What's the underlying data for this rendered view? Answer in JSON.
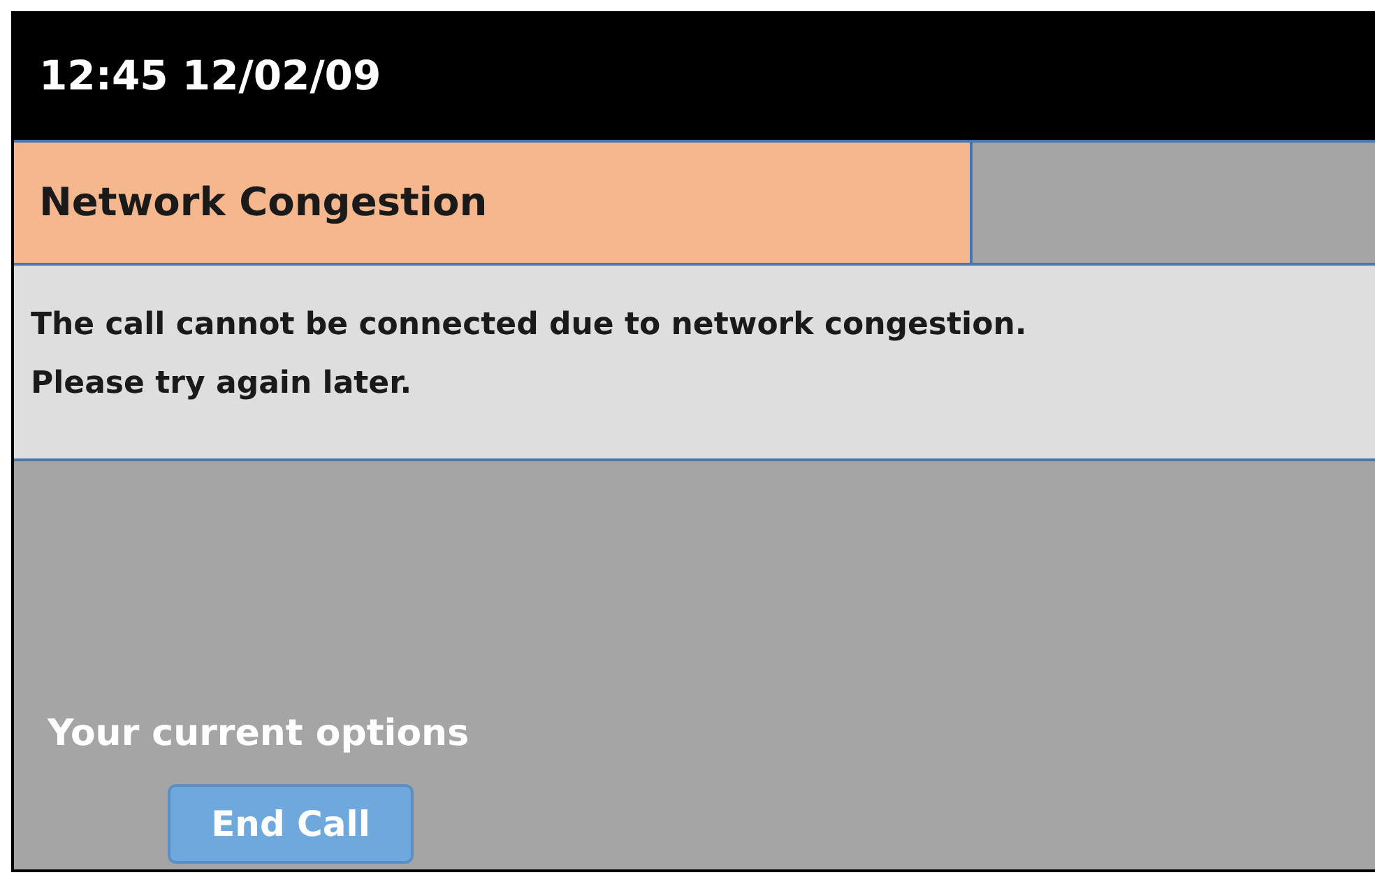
{
  "status_bar": {
    "datetime": "12:45 12/02/09"
  },
  "title": "Network Congestion",
  "message": "The call cannot be connected due to network congestion. Please try again later.",
  "options": {
    "heading": "Your current options",
    "buttons": [
      "End Call"
    ]
  }
}
